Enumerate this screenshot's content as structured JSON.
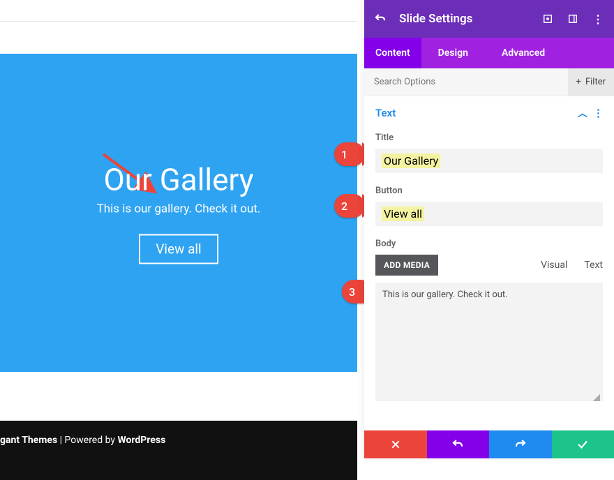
{
  "preview": {
    "title": "Our Gallery",
    "subtitle": "This is our gallery. Check it out.",
    "button_label": "View all"
  },
  "footer": {
    "brand": "gant Themes",
    "separator": " | Powered by ",
    "platform": "WordPress"
  },
  "callouts": {
    "c1": "1",
    "c2": "2",
    "c3": "3"
  },
  "panel": {
    "title": "Slide Settings",
    "tabs": {
      "content": "Content",
      "design": "Design",
      "advanced": "Advanced"
    },
    "search_placeholder": "Search Options",
    "filter_label": "Filter",
    "section": "Text",
    "labels": {
      "title": "Title",
      "button": "Button",
      "body": "Body",
      "add_media": "ADD MEDIA",
      "visual": "Visual",
      "text": "Text"
    },
    "values": {
      "title": "Our Gallery",
      "button": "View all",
      "body": "This is our gallery. Check it out."
    }
  }
}
